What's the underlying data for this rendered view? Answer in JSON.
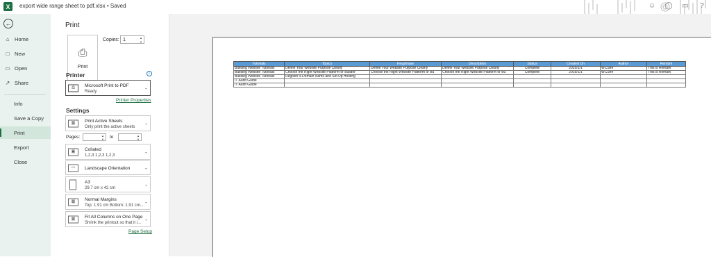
{
  "titlebar": {
    "app_icon": "excel-icon",
    "title": "export wide range sheet to pdf.xlsx • Saved"
  },
  "nav": {
    "items": [
      {
        "label": "Home",
        "icon": "home-icon"
      },
      {
        "label": "New",
        "icon": "new-file-icon"
      },
      {
        "label": "Open",
        "icon": "folder-icon"
      },
      {
        "label": "Share",
        "icon": "share-icon"
      },
      {
        "label": "Info"
      },
      {
        "label": "Save a Copy"
      },
      {
        "label": "Print"
      },
      {
        "label": "Export"
      },
      {
        "label": "Close"
      }
    ],
    "active": "Print"
  },
  "print": {
    "title": "Print",
    "button_label": "Print",
    "copies_label": "Copies:",
    "copies_value": "1",
    "printer_section": "Printer",
    "printer_name": "Microsoft Print to PDF",
    "printer_status": "Ready",
    "printer_properties": "Printer Properties",
    "settings_section": "Settings",
    "settings": [
      {
        "title": "Print Active Sheets",
        "sub": "Only print the active sheets"
      },
      {
        "title": "Collated",
        "sub": "1,2,3    1,2,3    1,2,3"
      },
      {
        "title": "Landscape Orientation",
        "sub": ""
      },
      {
        "title": "A3",
        "sub": "29.7 cm x 42 cm"
      },
      {
        "title": "Normal Margins",
        "sub": "Top: 1.91 cm Bottom: 1.91 cm..."
      },
      {
        "title": "Fit All Columns on One Page",
        "sub": "Shrink the printout so that it i..."
      }
    ],
    "pages_label": "Pages:",
    "to_label": "to",
    "page_setup": "Page Setup"
  },
  "preview": {
    "headers": [
      "Tutorials",
      "Topics",
      "Keyphrase",
      "Description",
      "Status",
      "Created On",
      "Author",
      "Remark"
    ],
    "rows": [
      [
        "Building Website Tutorials",
        "Define Your Website Purpose Clearly",
        "Define Your Website Purpose Clearly",
        "Define Your Website Purpose Clearly",
        "Complete",
        "2025/1/1",
        "WCSee",
        "This is Remark"
      ],
      [
        "Building Website Tutorials",
        "Choose the Right Website Platform or Builder",
        "Choose the Right Website Platform or Bu",
        "Choose the Right Website Platform or Bu",
        "Complete",
        "2025/1/1",
        "WCSee",
        "This is Remark"
      ],
      [
        "Building Website Tutorials",
        "Register a Domain Name and Set Up Hosting",
        "",
        "",
        "",
        "",
        "",
        ""
      ],
      [
        "IT Audit Guide",
        "",
        "",
        "",
        "",
        "",
        "",
        ""
      ],
      [
        "IT Audit Guide",
        "",
        "",
        "",
        "",
        "",
        "",
        ""
      ]
    ]
  }
}
